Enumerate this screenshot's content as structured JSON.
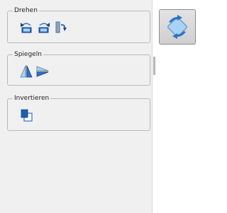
{
  "groups": {
    "rotate": {
      "title": "Drehen",
      "buttons": [
        {
          "icon": "rotate-left-icon"
        },
        {
          "icon": "rotate-right-icon"
        },
        {
          "icon": "rotate-180-icon"
        }
      ]
    },
    "mirror": {
      "title": "Spiegeln",
      "buttons": [
        {
          "icon": "flip-horizontal-icon"
        },
        {
          "icon": "flip-vertical-icon"
        }
      ]
    },
    "invert": {
      "title": "Invertieren",
      "buttons": [
        {
          "icon": "invert-icon"
        }
      ]
    }
  },
  "side_button": {
    "icon": "rotate-transform-icon"
  },
  "colors": {
    "panel_bg": "#f0f0f0",
    "icon_blue": "#2a73c9",
    "icon_dark": "#1e3f8a",
    "icon_light": "#a9d3f4"
  }
}
